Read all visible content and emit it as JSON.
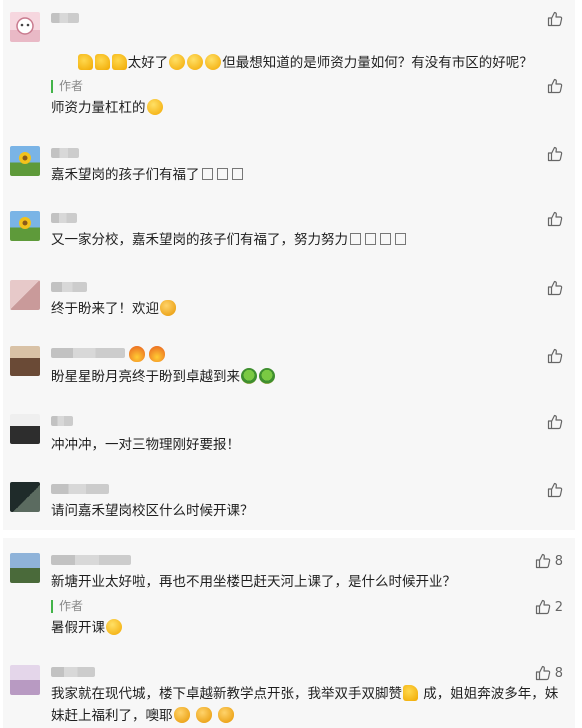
{
  "comments": [
    {
      "text": "太好了",
      "text_suffix": "但最想知道的是师资力量如何？有没有市区的好呢？",
      "reply": {
        "label": "作者",
        "text": "师资力量杠杠的"
      }
    },
    {
      "text": "嘉禾望岗的孩子们有福了"
    },
    {
      "text": "又一家分校，嘉禾望岗的孩子们有福了，努力努力"
    },
    {
      "text": "终于盼来了！欢迎"
    },
    {
      "text": "盼星星盼月亮终于盼到卓越到来"
    },
    {
      "text": "冲冲冲，一对三物理刚好要报！"
    },
    {
      "text": "请问嘉禾望岗校区什么时候开课？"
    },
    {
      "text": "新塘开业太好啦，再也不用坐楼巴赶天河上课了，是什么时候开业？",
      "likes": "8",
      "reply": {
        "label": "作者",
        "text": "暑假开课",
        "likes": "2"
      }
    },
    {
      "text": "我家就在现代城，楼下卓越新教学点开张，我举双手双脚赞",
      "text_mid": " 成，姐姐奔波多年，妹妹赶上福利了，噢耶",
      "likes": "8"
    }
  ],
  "icons": {
    "like": "thumbs-up-outline-icon"
  },
  "colors": {
    "author_bar": "#43b449",
    "card_bg": "#f7f7f7"
  }
}
